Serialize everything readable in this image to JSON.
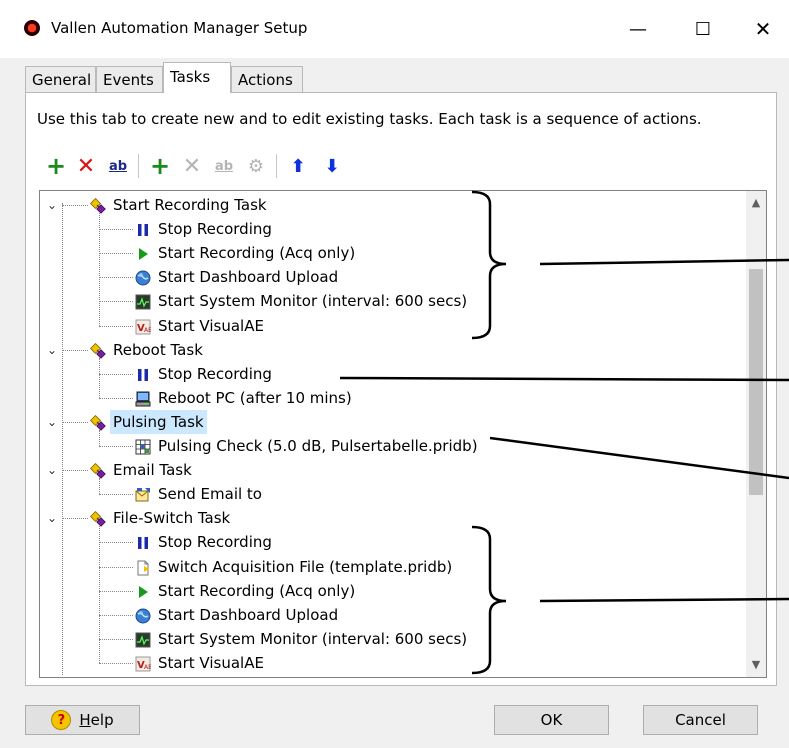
{
  "window": {
    "title": "Vallen Automation Manager Setup"
  },
  "titlebar": {
    "min": "—",
    "max": "☐",
    "close": "✕"
  },
  "tabs": [
    {
      "label": "General",
      "active": false
    },
    {
      "label": "Events",
      "active": false
    },
    {
      "label": "Tasks",
      "active": true
    },
    {
      "label": "Actions",
      "active": false
    }
  ],
  "description": "Use this tab to create new and to edit existing tasks. Each task is a sequence of actions.",
  "toolbar": {
    "add_task": "+",
    "delete_task": "✕",
    "rename_task": "ab",
    "add_action": "+",
    "delete_action": "✕",
    "rename_action": "ab",
    "edit_action": "⚙",
    "move_up": "⬆",
    "move_down": "⬇"
  },
  "tree": {
    "tasks": [
      {
        "label": "Start Recording Task",
        "selected": false,
        "actions": [
          {
            "label": "Stop Recording",
            "icon": "pause-icon"
          },
          {
            "label": "Start Recording (Acq only)",
            "icon": "play-icon"
          },
          {
            "label": "Start Dashboard Upload",
            "icon": "globe-icon"
          },
          {
            "label": "Start System Monitor (interval: 600 secs)",
            "icon": "monitor-icon"
          },
          {
            "label": "Start VisualAE",
            "icon": "visualae-icon"
          }
        ]
      },
      {
        "label": "Reboot Task",
        "selected": false,
        "actions": [
          {
            "label": "Stop Recording",
            "icon": "pause-icon"
          },
          {
            "label": "Reboot PC (after 10 mins)",
            "icon": "computer-icon"
          }
        ]
      },
      {
        "label": "Pulsing Task",
        "selected": true,
        "actions": [
          {
            "label": "Pulsing Check (5.0 dB, Pulsertabelle.pridb)",
            "icon": "grid-icon"
          }
        ]
      },
      {
        "label": "Email Task",
        "selected": false,
        "actions": [
          {
            "label": "Send Email to",
            "icon": "email-icon"
          }
        ]
      },
      {
        "label": "File-Switch Task",
        "selected": false,
        "actions": [
          {
            "label": "Stop Recording",
            "icon": "pause-icon"
          },
          {
            "label": "Switch Acquisition File (template.pridb)",
            "icon": "file-icon"
          },
          {
            "label": "Start Recording (Acq only)",
            "icon": "play-icon"
          },
          {
            "label": "Start Dashboard Upload",
            "icon": "globe-icon"
          },
          {
            "label": "Start System Monitor (interval: 600 secs)",
            "icon": "monitor-icon"
          },
          {
            "label": "Start VisualAE",
            "icon": "visualae-icon"
          }
        ]
      }
    ]
  },
  "buttons": {
    "help_prefix": "",
    "help_hotkey": "H",
    "help_rest": "elp",
    "ok": "OK",
    "cancel": "Cancel"
  }
}
